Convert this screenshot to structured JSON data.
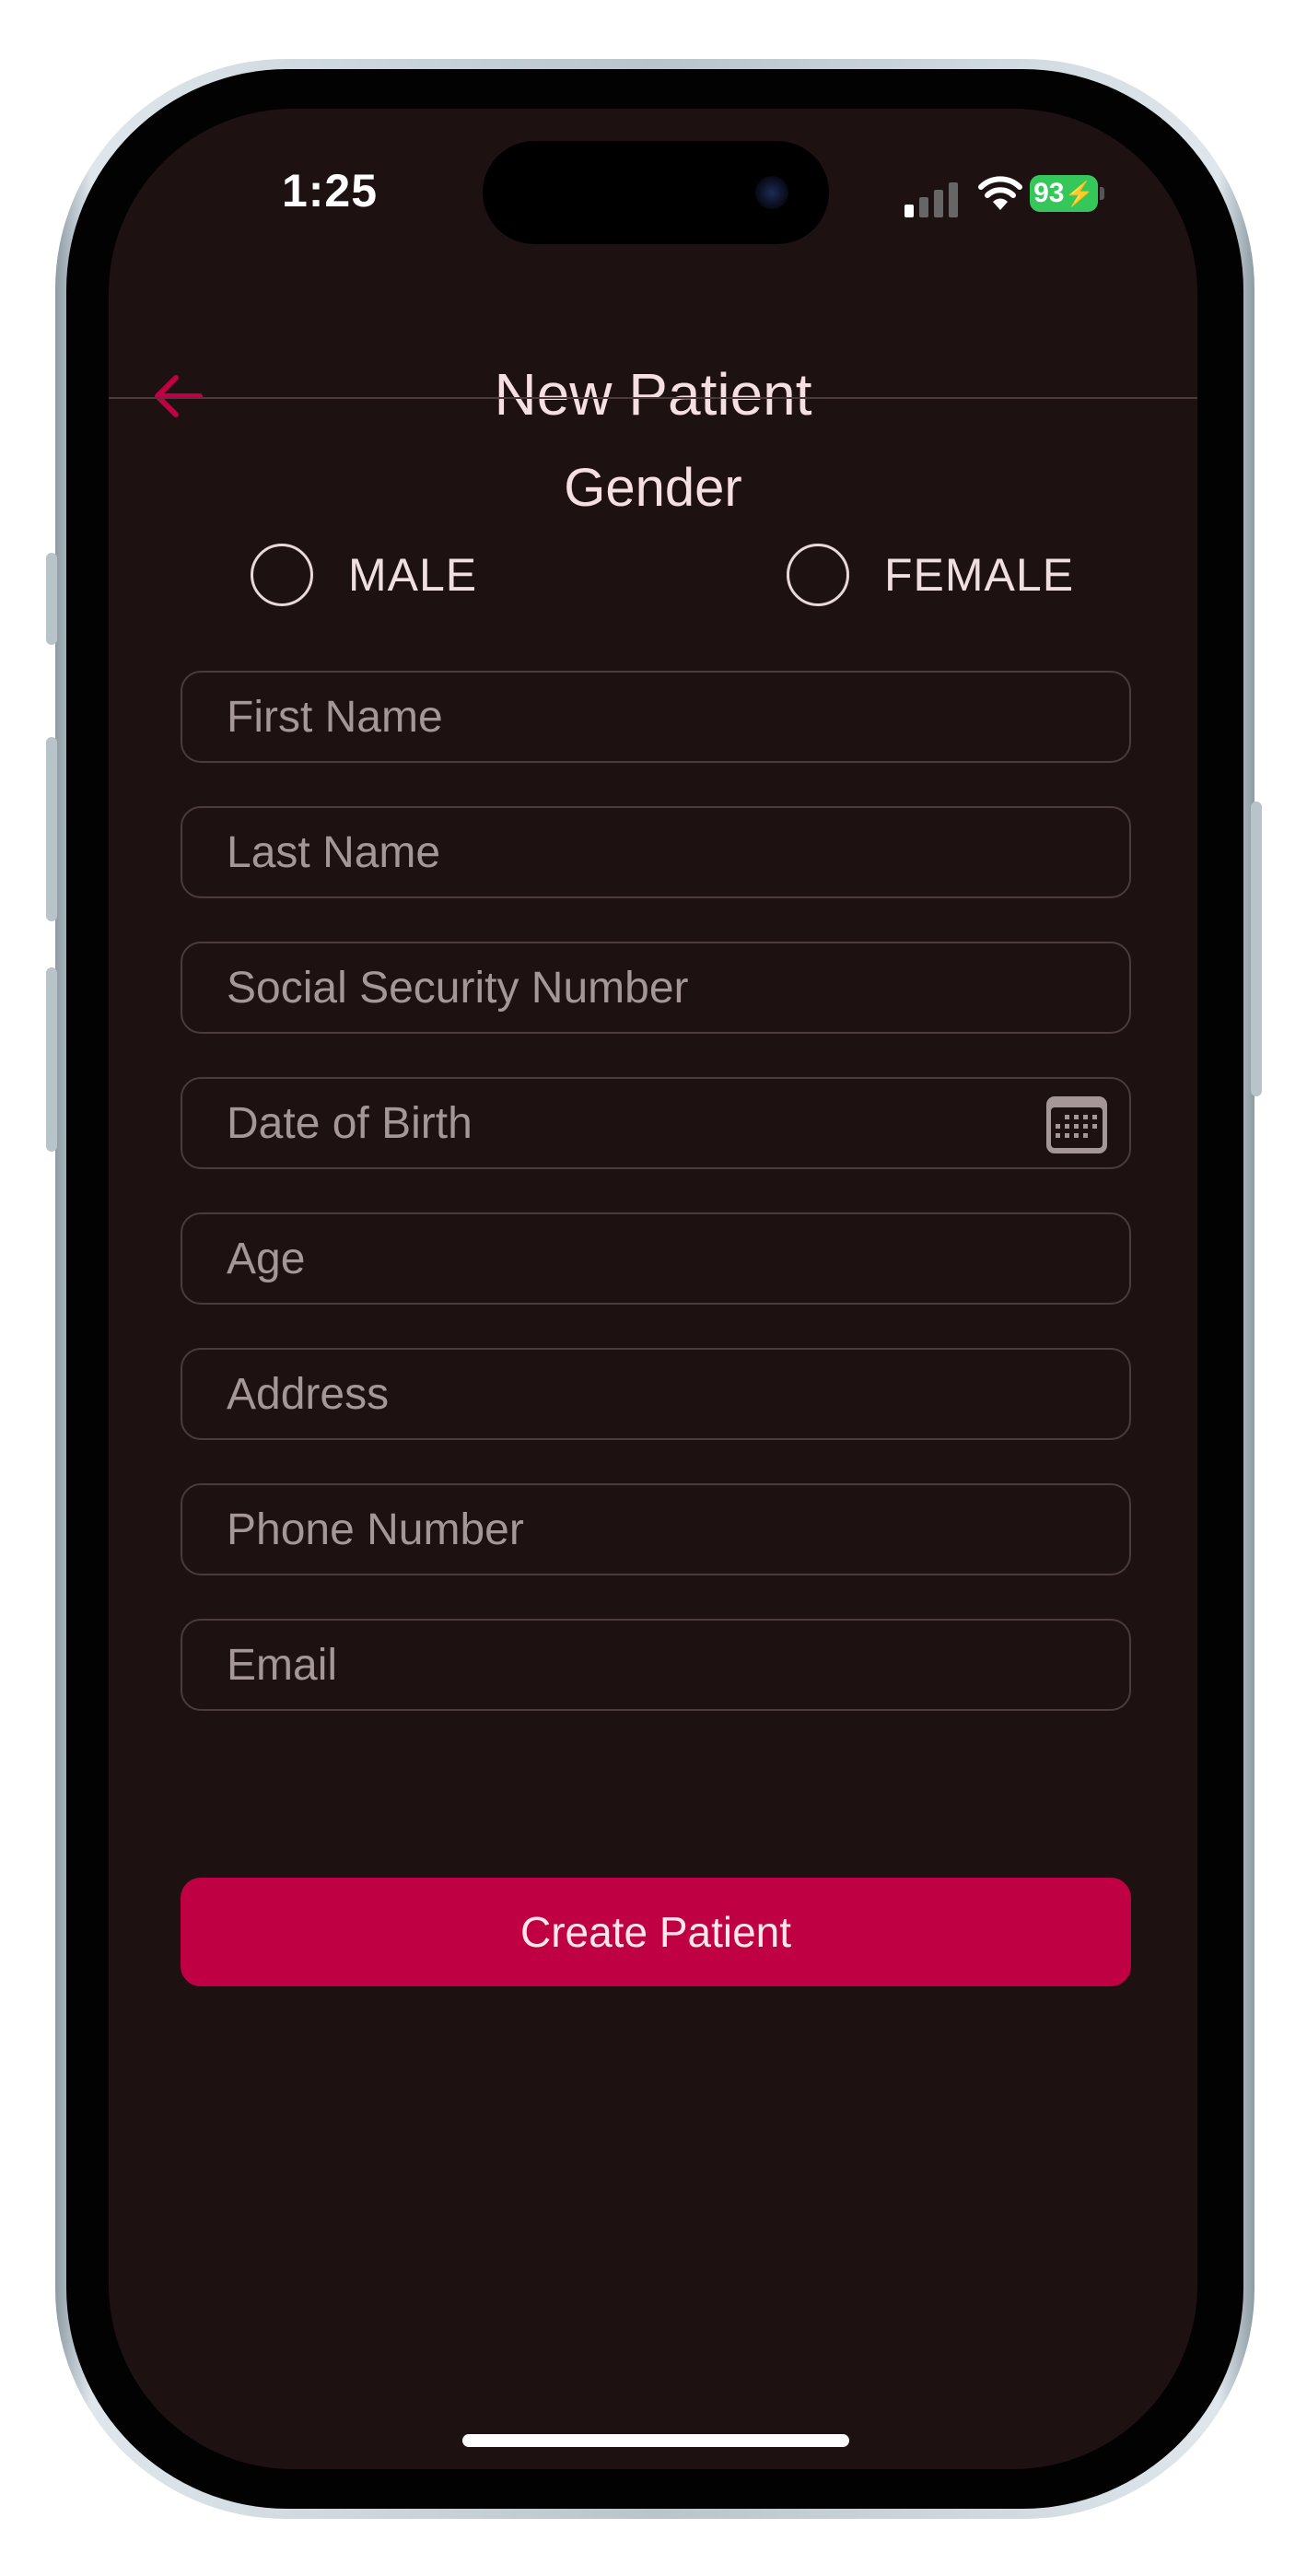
{
  "status_bar": {
    "time": "1:25",
    "battery": "93"
  },
  "header": {
    "title": "New Patient",
    "back_icon": "arrow-left-icon"
  },
  "gender": {
    "label": "Gender",
    "options": [
      {
        "label": "MALE",
        "selected": false
      },
      {
        "label": "FEMALE",
        "selected": false
      }
    ]
  },
  "form": {
    "fields": [
      {
        "placeholder": "First Name",
        "value": ""
      },
      {
        "placeholder": "Last Name",
        "value": ""
      },
      {
        "placeholder": "Social Security Number",
        "value": ""
      },
      {
        "placeholder": "Date of Birth",
        "value": "",
        "icon": "calendar-icon"
      },
      {
        "placeholder": "Age",
        "value": ""
      },
      {
        "placeholder": "Address",
        "value": ""
      },
      {
        "placeholder": "Phone Number",
        "value": ""
      },
      {
        "placeholder": "Email",
        "value": ""
      }
    ],
    "submit_label": "Create Patient"
  },
  "colors": {
    "background": "#1e1112",
    "accent": "#bf0042",
    "text": "#f5dfe0",
    "placeholder": "#a59798",
    "border": "#4c3b3c"
  }
}
